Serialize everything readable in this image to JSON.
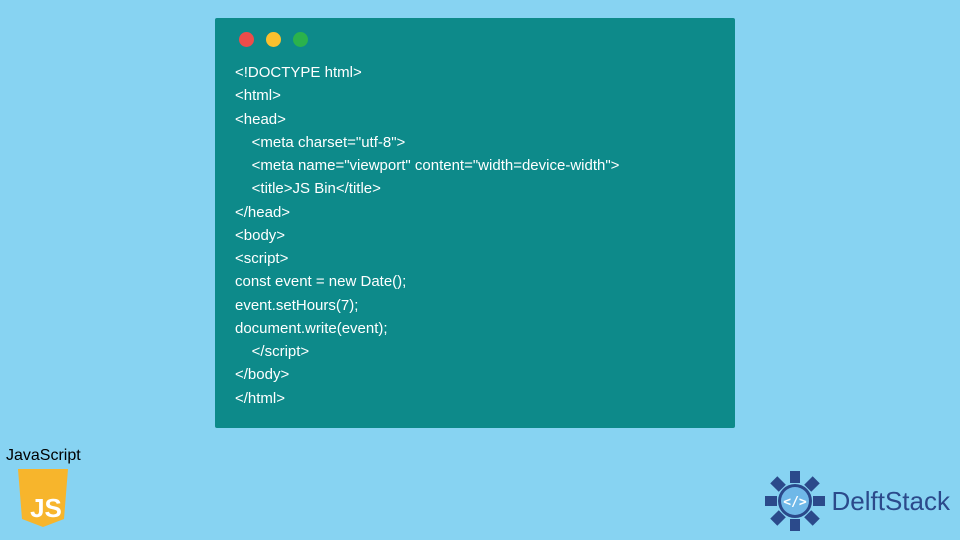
{
  "codeWindow": {
    "lines": [
      "<!DOCTYPE html>",
      "<html>",
      "<head>",
      "    <meta charset=\"utf-8\">",
      "    <meta name=\"viewport\" content=\"width=device-width\">",
      "    <title>JS Bin</title>",
      "</head>",
      "<body>",
      "<script>",
      "const event = new Date();",
      "event.setHours(7);",
      "document.write(event);",
      "    </script>",
      "</body>",
      "</html>"
    ]
  },
  "jsBadge": {
    "label": "JavaScript",
    "shieldText": "JS"
  },
  "brand": {
    "text": "DelftStack",
    "iconGlyph": "</>"
  },
  "colors": {
    "pageBg": "#87d3f2",
    "windowBg": "#0d8a8a",
    "dotRed": "#ed4c4a",
    "dotYellow": "#fbc02d",
    "dotGreen": "#2bb24c",
    "jsShield": "#f7b52c",
    "brandBlue": "#2b4a8b"
  }
}
